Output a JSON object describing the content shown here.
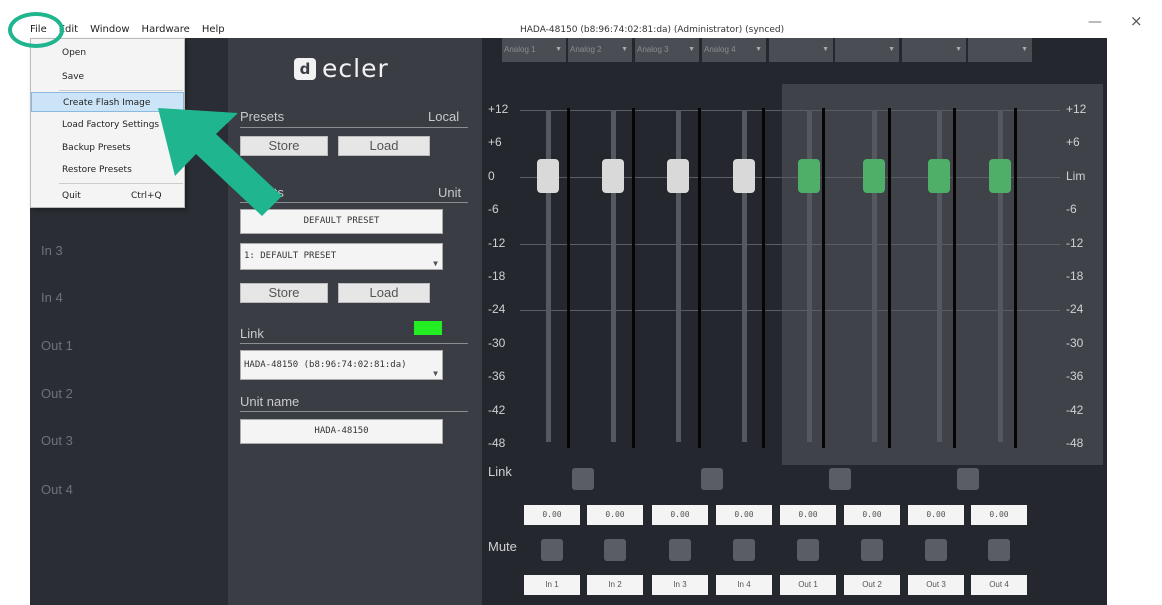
{
  "menubar": [
    "File",
    "Edit",
    "Window",
    "Hardware",
    "Help"
  ],
  "window": {
    "title": "HADA-48150 (b8:96:74:02:81:da) (Administrator) (synced)",
    "minimize": "—",
    "close": "×"
  },
  "file_menu": {
    "items": [
      {
        "label": "Open"
      },
      {
        "label": "Save"
      },
      {
        "label": "Create Flash Image"
      },
      {
        "label": "Load Factory Settings"
      },
      {
        "label": "Backup Presets"
      },
      {
        "label": "Restore Presets"
      },
      {
        "label": "Quit",
        "shortcut": "Ctrl+Q"
      }
    ]
  },
  "left_nav": [
    "In 3",
    "In 4",
    "Out 1",
    "Out 2",
    "Out 3",
    "Out 4"
  ],
  "panel": {
    "logo_icon": "d",
    "logo_text": "ecler",
    "presets_local_label": "Presets",
    "presets_local_right": "Local",
    "store": "Store",
    "load": "Load",
    "presets_unit_label": "sets",
    "presets_unit_right": "Unit",
    "default_preset_button": "DEFAULT PRESET",
    "preset_select": "1: DEFAULT PRESET",
    "link_label": "Link",
    "link_device": "HADA-48150 (b8:96:74:02:81:da)",
    "unit_name_label": "Unit name",
    "unit_name_value": "HADA-48150",
    "link_led_color": "#22ee22"
  },
  "mixer": {
    "channel_tabs": [
      "Analog 1",
      "Analog 2",
      "Analog 3",
      "Analog 4",
      "",
      "",
      "",
      ""
    ],
    "scale_left": [
      "+12",
      "+6",
      "0",
      "-6",
      "-12",
      "-18",
      "-24",
      "-30",
      "-36",
      "-42",
      "-48"
    ],
    "scale_right": [
      "+12",
      "+6",
      "Lim",
      "-6",
      "-12",
      "-18",
      "-24",
      "-30",
      "-36",
      "-42",
      "-48"
    ],
    "link_label": "Link",
    "mute_label": "Mute",
    "values": [
      "0.00",
      "0.00",
      "0.00",
      "0.00",
      "0.00",
      "0.00",
      "0.00",
      "0.00"
    ],
    "channel_names": [
      "In 1",
      "In 2",
      "In 3",
      "In 4",
      "Out 1",
      "Out 2",
      "Out 3",
      "Out 4"
    ],
    "knob_colors": [
      "#d9d9d9",
      "#4fae68"
    ],
    "highlight_color": "#1fb58f"
  }
}
